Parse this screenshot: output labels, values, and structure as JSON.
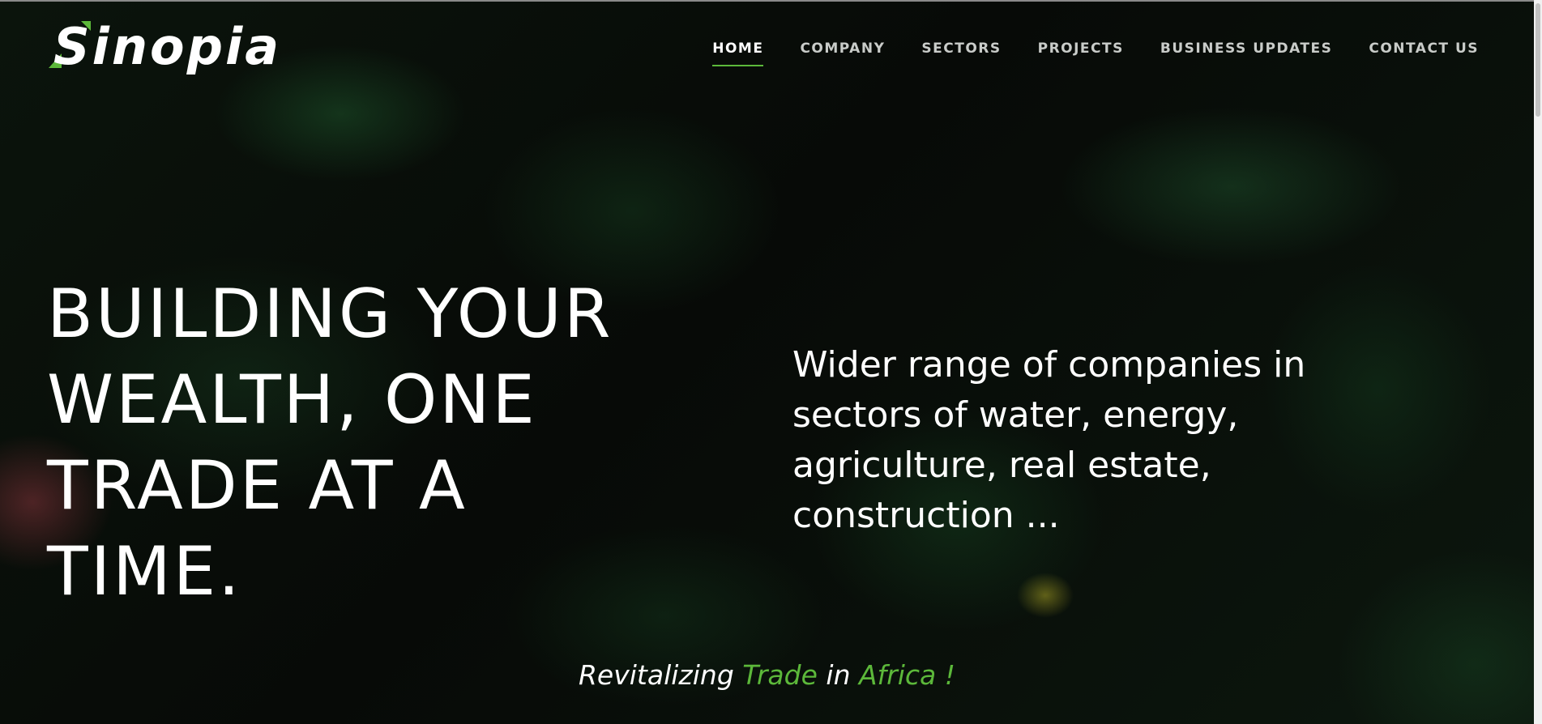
{
  "brand": {
    "name": "Sinopia",
    "accent_color": "#5cb83a"
  },
  "nav": {
    "items": [
      {
        "label": "HOME",
        "active": true
      },
      {
        "label": "COMPANY",
        "active": false
      },
      {
        "label": "SECTORS",
        "active": false
      },
      {
        "label": "PROJECTS",
        "active": false
      },
      {
        "label": "BUSINESS UPDATES",
        "active": false
      },
      {
        "label": "CONTACT US",
        "active": false
      }
    ]
  },
  "hero": {
    "headline_lines": [
      "BUILDING YOUR",
      "WEALTH, ONE",
      "TRADE AT A",
      "TIME."
    ],
    "tagline": "Wider range of companies in sectors of water, energy, agriculture, real estate, construction ...",
    "slogan": {
      "part1": "Revitalizing ",
      "part2": "Trade",
      "part3": " in ",
      "part4": "Africa !"
    }
  }
}
